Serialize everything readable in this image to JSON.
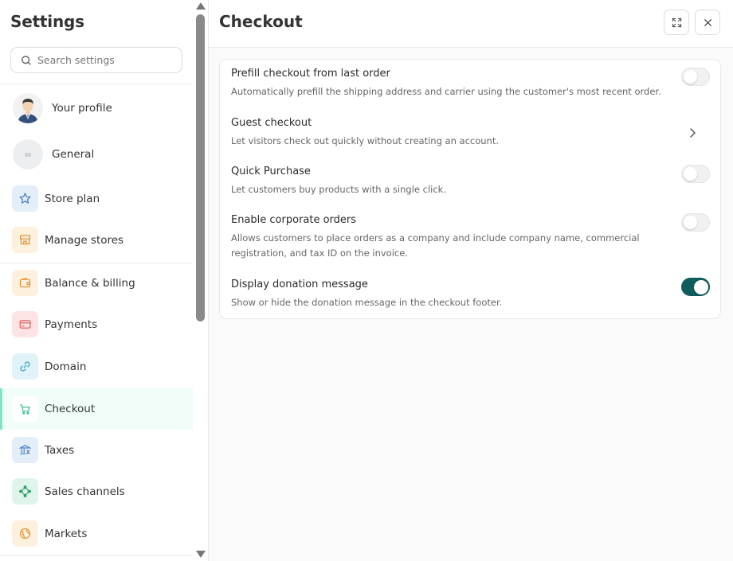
{
  "sidebar": {
    "title": "Settings",
    "search_placeholder": "Search settings",
    "items": [
      {
        "label": "Your profile"
      },
      {
        "label": "General"
      },
      {
        "label": "Store plan"
      },
      {
        "label": "Manage stores"
      },
      {
        "label": "Balance & billing"
      },
      {
        "label": "Payments"
      },
      {
        "label": "Domain"
      },
      {
        "label": "Checkout",
        "active": true
      },
      {
        "label": "Taxes"
      },
      {
        "label": "Sales channels"
      },
      {
        "label": "Markets"
      }
    ]
  },
  "main": {
    "title": "Checkout",
    "settings": [
      {
        "title": "Prefill checkout from last order",
        "description": "Automatically prefill the shipping address and carrier using the customer's most recent order.",
        "control": "toggle",
        "enabled": false
      },
      {
        "title": "Guest checkout",
        "description": "Let visitors check out quickly without creating an account.",
        "control": "chevron"
      },
      {
        "title": "Quick Purchase",
        "description": "Let customers buy products with a single click.",
        "control": "toggle",
        "enabled": false
      },
      {
        "title": "Enable corporate orders",
        "description": "Allows customers to place orders as a company and include company name, commercial registration, and tax ID on the invoice.",
        "control": "toggle",
        "enabled": false
      },
      {
        "title": "Display donation message",
        "description": "Show or hide the donation message in the checkout footer.",
        "control": "toggle",
        "enabled": true
      }
    ]
  },
  "colors": {
    "accent": "#0f5b5d",
    "active_nav_bg": "#f0fdf9",
    "active_nav_border": "#7ee6c6"
  },
  "icons": {
    "search": "search-icon",
    "expand": "expand-icon",
    "close": "close-icon",
    "chevron": "chevron-right-icon"
  }
}
